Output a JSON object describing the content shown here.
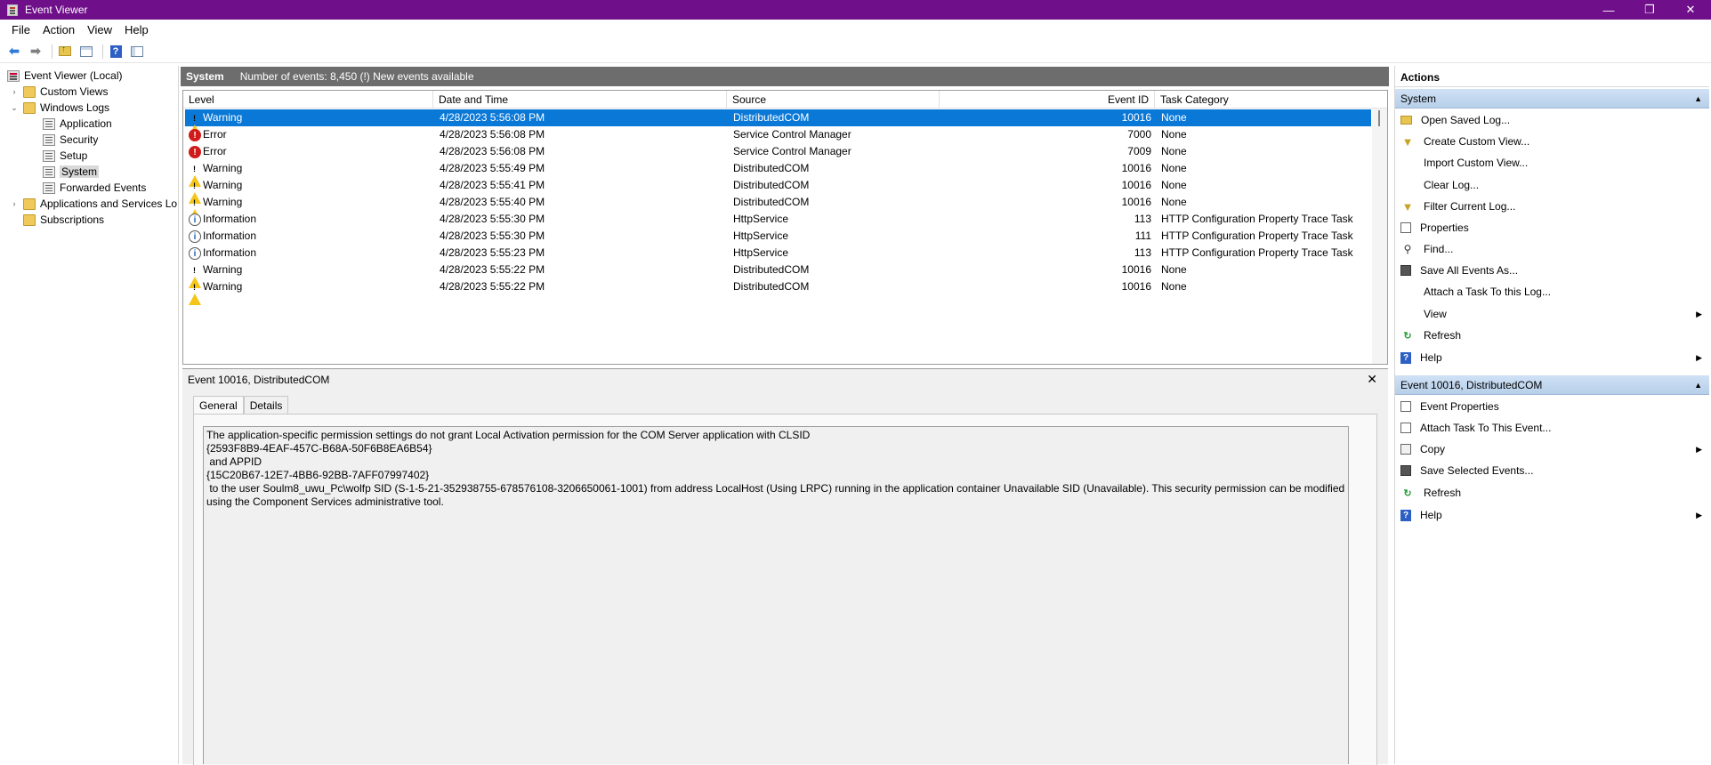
{
  "window": {
    "title": "Event Viewer",
    "controls": {
      "minimize": "—",
      "restore": "❐",
      "close": "✕"
    }
  },
  "menu": [
    "File",
    "Action",
    "View",
    "Help"
  ],
  "tree": {
    "root": "Event Viewer (Local)",
    "custom_views": "Custom Views",
    "windows_logs": "Windows Logs",
    "logs": [
      "Application",
      "Security",
      "Setup",
      "System",
      "Forwarded Events"
    ],
    "apps_services": "Applications and Services Lo",
    "subscriptions": "Subscriptions"
  },
  "center": {
    "log_name": "System",
    "summary": "Number of events: 8,450 (!) New events available",
    "columns": [
      "Level",
      "Date and Time",
      "Source",
      "Event ID",
      "Task Category"
    ],
    "rows": [
      {
        "level": "Warning",
        "icon": "warning-icon",
        "datetime": "4/28/2023 5:56:08 PM",
        "source": "DistributedCOM",
        "event_id": "10016",
        "category": "None"
      },
      {
        "level": "Error",
        "icon": "error-icon",
        "datetime": "4/28/2023 5:56:08 PM",
        "source": "Service Control Manager",
        "event_id": "7000",
        "category": "None"
      },
      {
        "level": "Error",
        "icon": "error-icon",
        "datetime": "4/28/2023 5:56:08 PM",
        "source": "Service Control Manager",
        "event_id": "7009",
        "category": "None"
      },
      {
        "level": "Warning",
        "icon": "warning-icon",
        "datetime": "4/28/2023 5:55:49 PM",
        "source": "DistributedCOM",
        "event_id": "10016",
        "category": "None"
      },
      {
        "level": "Warning",
        "icon": "warning-icon",
        "datetime": "4/28/2023 5:55:41 PM",
        "source": "DistributedCOM",
        "event_id": "10016",
        "category": "None"
      },
      {
        "level": "Warning",
        "icon": "warning-icon",
        "datetime": "4/28/2023 5:55:40 PM",
        "source": "DistributedCOM",
        "event_id": "10016",
        "category": "None"
      },
      {
        "level": "Information",
        "icon": "info-icon",
        "datetime": "4/28/2023 5:55:30 PM",
        "source": "HttpService",
        "event_id": "113",
        "category": "HTTP Configuration Property Trace Task"
      },
      {
        "level": "Information",
        "icon": "info-icon",
        "datetime": "4/28/2023 5:55:30 PM",
        "source": "HttpService",
        "event_id": "111",
        "category": "HTTP Configuration Property Trace Task"
      },
      {
        "level": "Information",
        "icon": "info-icon",
        "datetime": "4/28/2023 5:55:23 PM",
        "source": "HttpService",
        "event_id": "113",
        "category": "HTTP Configuration Property Trace Task"
      },
      {
        "level": "Warning",
        "icon": "warning-icon",
        "datetime": "4/28/2023 5:55:22 PM",
        "source": "DistributedCOM",
        "event_id": "10016",
        "category": "None"
      },
      {
        "level": "Warning",
        "icon": "warning-icon",
        "datetime": "4/28/2023 5:55:22 PM",
        "source": "DistributedCOM",
        "event_id": "10016",
        "category": "None"
      }
    ],
    "detail": {
      "title": "Event 10016, DistributedCOM",
      "close": "✕",
      "tabs": [
        "General",
        "Details"
      ],
      "description": "The application-specific permission settings do not grant Local Activation permission for the COM Server application with CLSID \n{2593F8B9-4EAF-457C-B68A-50F6B8EA6B54}\n and APPID \n{15C20B67-12E7-4BB6-92BB-7AFF07997402}\n to the user Soulm8_uwu_Pc\\wolfp SID (S-1-5-21-352938755-678576108-3206650061-1001) from address LocalHost (Using LRPC) running in the application container Unavailable SID (Unavailable). This security permission can be modified using the Component Services administrative tool."
    }
  },
  "actions": {
    "title": "Actions",
    "section1": "System",
    "items1": [
      {
        "label": "Open Saved Log...",
        "icon": "open-log-icon"
      },
      {
        "label": "Create Custom View...",
        "icon": "filter-icon"
      },
      {
        "label": "Import Custom View...",
        "icon": ""
      },
      {
        "label": "Clear Log...",
        "icon": ""
      },
      {
        "label": "Filter Current Log...",
        "icon": "filter-icon"
      },
      {
        "label": "Properties",
        "icon": "properties-icon"
      },
      {
        "label": "Find...",
        "icon": "find-icon"
      },
      {
        "label": "Save All Events As...",
        "icon": "save-icon"
      },
      {
        "label": "Attach a Task To this Log...",
        "icon": ""
      },
      {
        "label": "View",
        "icon": ""
      },
      {
        "label": "Refresh",
        "icon": "refresh-icon"
      },
      {
        "label": "Help",
        "icon": "help-icon"
      }
    ],
    "section2": "Event 10016, DistributedCOM",
    "items2": [
      {
        "label": "Event Properties",
        "icon": "properties-icon"
      },
      {
        "label": "Attach Task To This Event...",
        "icon": "task-icon"
      },
      {
        "label": "Copy",
        "icon": "copy-icon"
      },
      {
        "label": "Save Selected Events...",
        "icon": "save-icon"
      },
      {
        "label": "Refresh",
        "icon": "refresh-icon"
      },
      {
        "label": "Help",
        "icon": "help-icon"
      }
    ]
  }
}
